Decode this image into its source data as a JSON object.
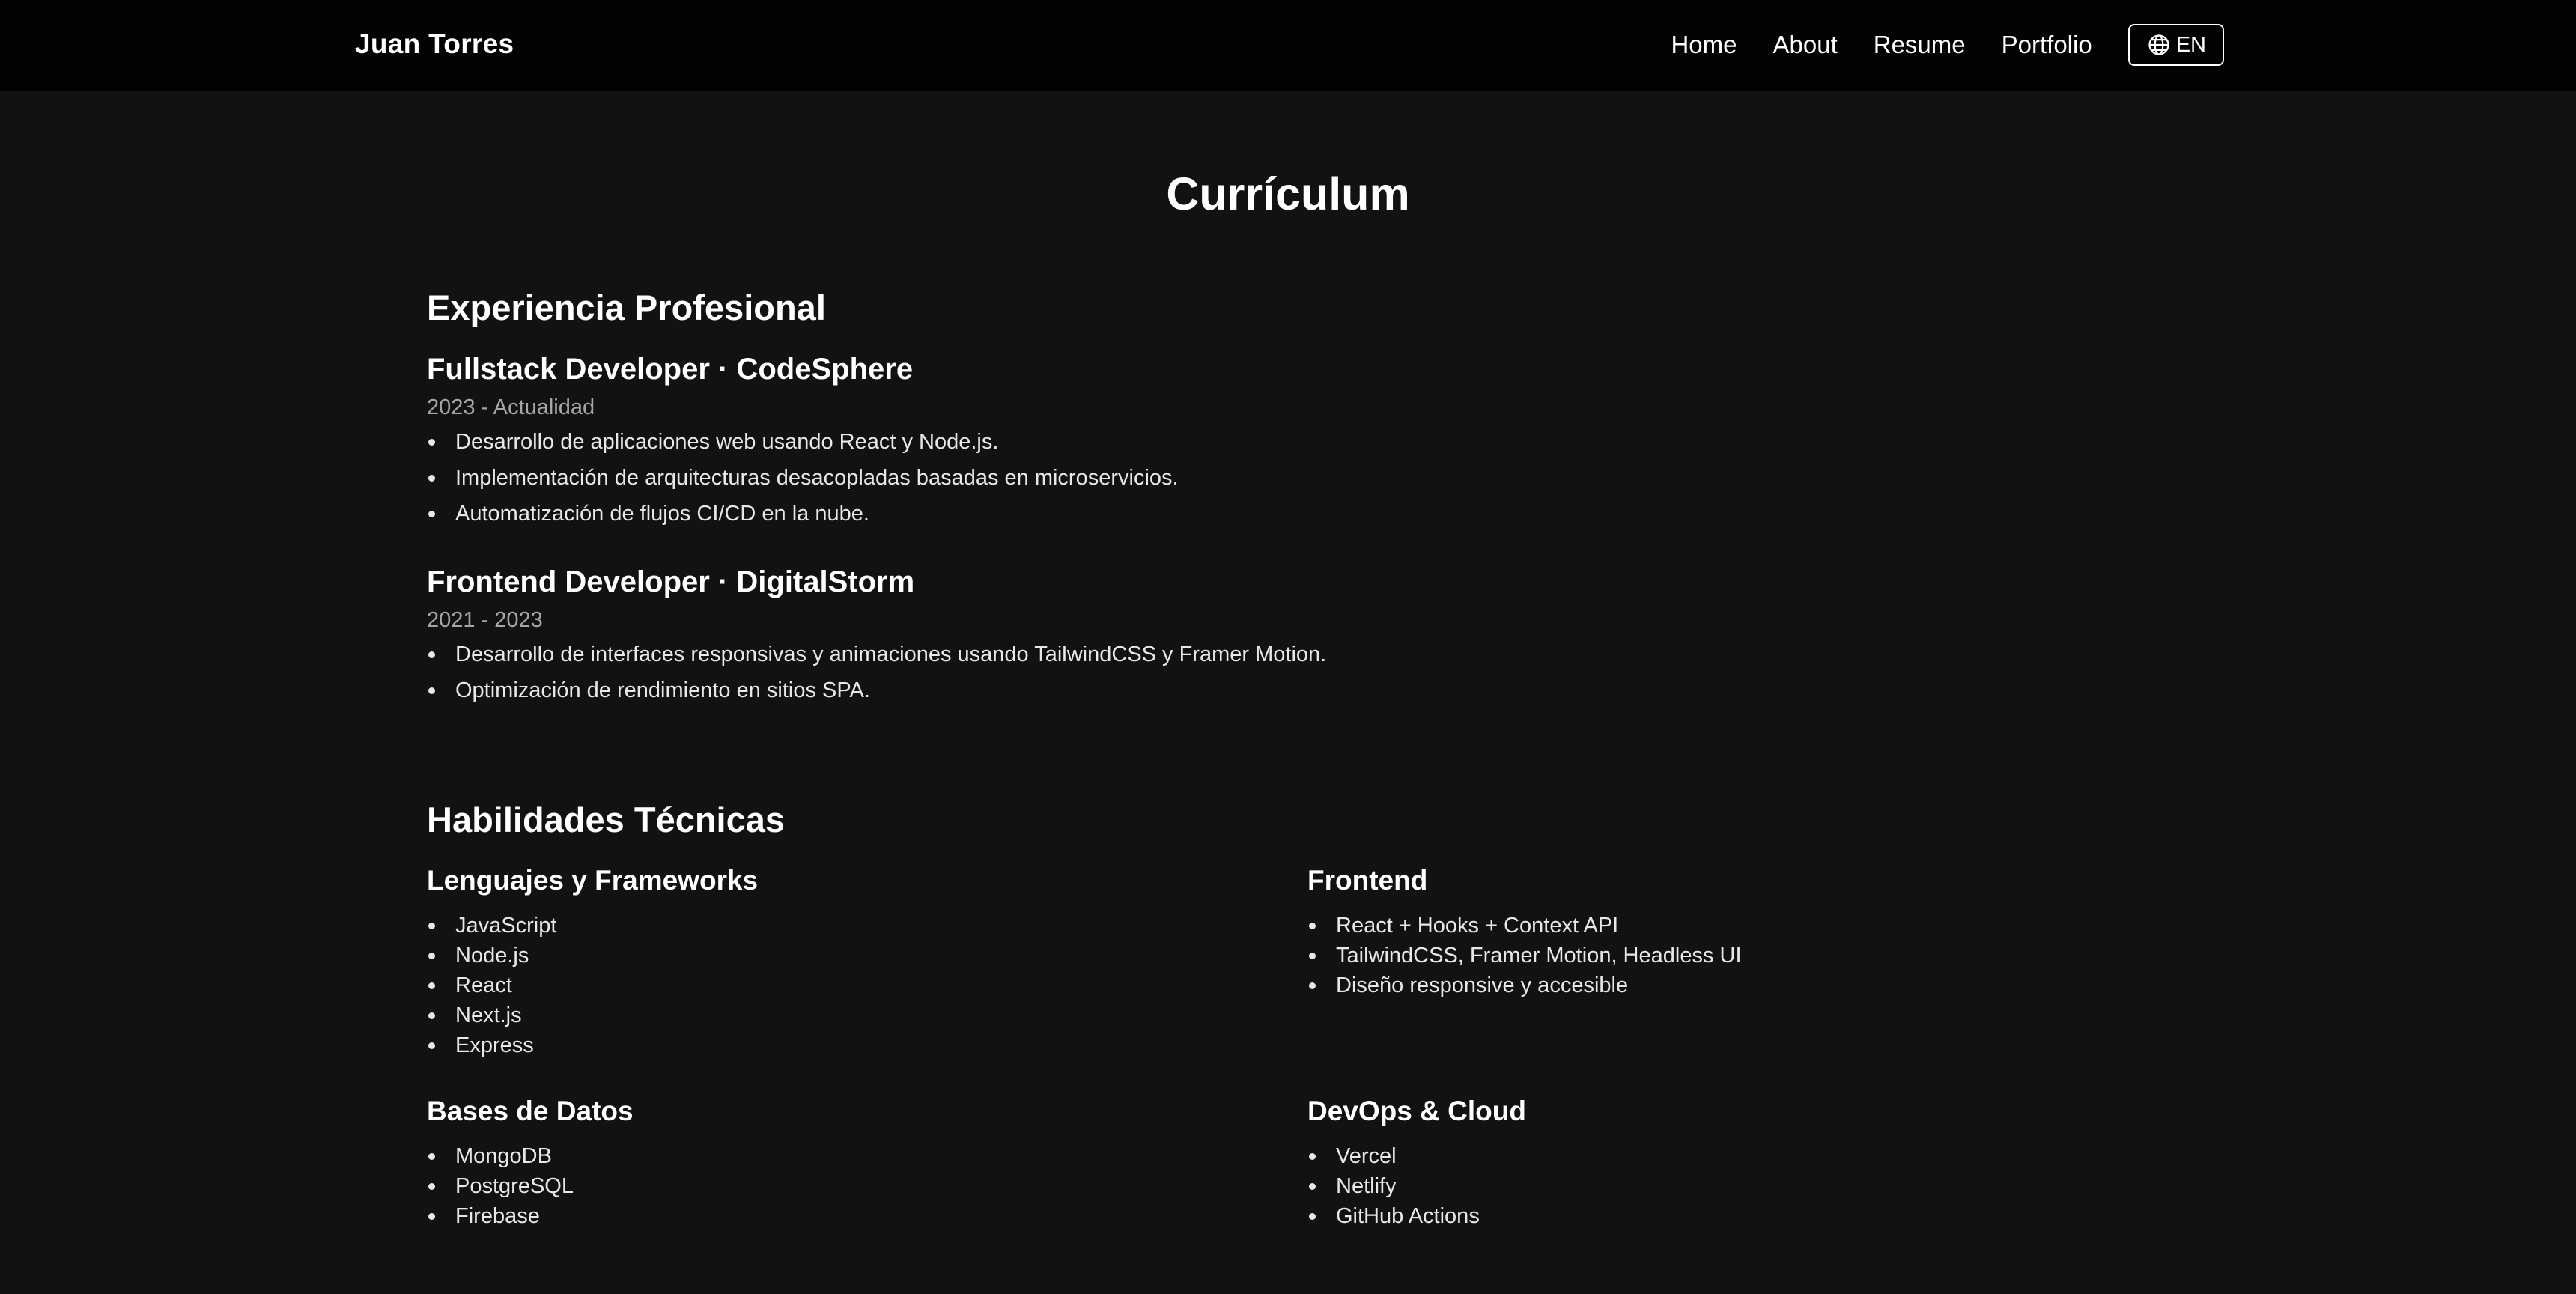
{
  "header": {
    "brand": "Juan Torres",
    "nav": [
      "Home",
      "About",
      "Resume",
      "Portfolio"
    ],
    "language_button": {
      "label": "EN",
      "icon": "globe-icon"
    }
  },
  "page": {
    "title": "Currículum"
  },
  "experience": {
    "title": "Experiencia Profesional",
    "jobs": [
      {
        "title": "Fullstack Developer · CodeSphere",
        "period": "2023 - Actualidad",
        "bullets": [
          "Desarrollo de aplicaciones web usando React y Node.js.",
          "Implementación de arquitecturas desacopladas basadas en microservicios.",
          "Automatización de flujos CI/CD en la nube."
        ]
      },
      {
        "title": "Frontend Developer · DigitalStorm",
        "period": "2021 - 2023",
        "bullets": [
          "Desarrollo de interfaces responsivas y animaciones usando TailwindCSS y Framer Motion.",
          "Optimización de rendimiento en sitios SPA."
        ]
      }
    ]
  },
  "skills": {
    "title": "Habilidades Técnicas",
    "groups": [
      {
        "title": "Lenguajes y Frameworks",
        "items": [
          "JavaScript",
          "Node.js",
          "React",
          "Next.js",
          "Express"
        ]
      },
      {
        "title": "Frontend",
        "items": [
          "React + Hooks + Context API",
          "TailwindCSS, Framer Motion, Headless UI",
          "Diseño responsive y accesible"
        ]
      },
      {
        "title": "Bases de Datos",
        "items": [
          "MongoDB",
          "PostgreSQL",
          "Firebase"
        ]
      },
      {
        "title": "DevOps & Cloud",
        "items": [
          "Vercel",
          "Netlify",
          "GitHub Actions"
        ]
      }
    ]
  },
  "colors": {
    "background": "#121212",
    "navbar": "#030303",
    "text": "#ffffff",
    "muted": "#a6a6a6"
  }
}
